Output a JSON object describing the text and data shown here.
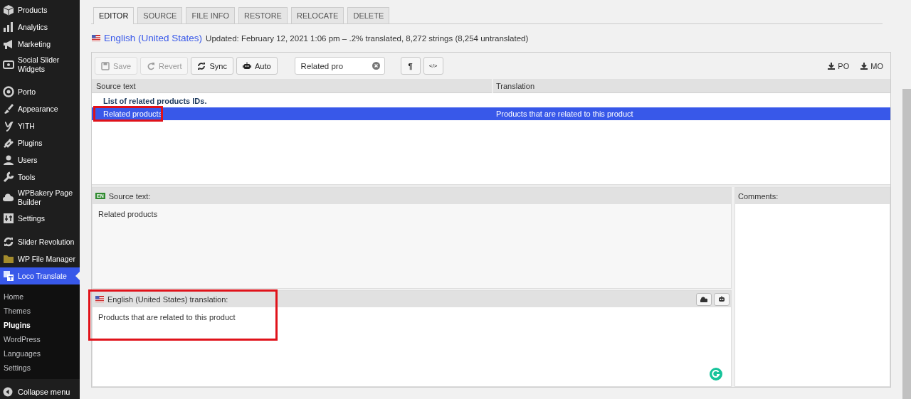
{
  "sidebar": {
    "groups": [
      [
        {
          "label": "Products",
          "selected": false
        },
        {
          "label": "Analytics",
          "selected": false
        },
        {
          "label": "Marketing",
          "selected": false
        },
        {
          "label": "Social Slider Widgets",
          "selected": false
        }
      ],
      [
        {
          "label": "Porto",
          "selected": false
        },
        {
          "label": "Appearance",
          "selected": false
        },
        {
          "label": "YITH",
          "selected": false
        },
        {
          "label": "Plugins",
          "selected": false
        },
        {
          "label": "Users",
          "selected": false
        },
        {
          "label": "Tools",
          "selected": false
        },
        {
          "label": "WPBakery Page Builder",
          "selected": false
        },
        {
          "label": "Settings",
          "selected": false
        }
      ],
      [
        {
          "label": "Slider Revolution",
          "selected": false
        },
        {
          "label": "WP File Manager",
          "selected": false
        },
        {
          "label": "Loco Translate",
          "selected": true
        }
      ]
    ],
    "submenu": [
      {
        "label": "Home",
        "selected": false
      },
      {
        "label": "Themes",
        "selected": false
      },
      {
        "label": "Plugins",
        "selected": true
      },
      {
        "label": "WordPress",
        "selected": false
      },
      {
        "label": "Languages",
        "selected": false
      },
      {
        "label": "Settings",
        "selected": false
      }
    ],
    "collapse": "Collapse menu"
  },
  "tabs": [
    {
      "label": "EDITOR",
      "selected": true
    },
    {
      "label": "SOURCE",
      "selected": false
    },
    {
      "label": "FILE INFO",
      "selected": false
    },
    {
      "label": "RESTORE",
      "selected": false
    },
    {
      "label": "RELOCATE",
      "selected": false
    },
    {
      "label": "DELETE",
      "selected": false
    }
  ],
  "header": {
    "language": "English (United States)",
    "meta": "Updated: February 12, 2021 1:06 pm – .2% translated, 8,272 strings (8,254 untranslated)"
  },
  "toolbar": {
    "buttons": [
      {
        "label": "Save",
        "disabled": true
      },
      {
        "label": "Revert",
        "disabled": true
      },
      {
        "label": "Sync",
        "disabled": false
      },
      {
        "label": "Auto",
        "disabled": false
      }
    ],
    "search": {
      "value": "Related pro"
    },
    "toggles": [
      "¶",
      "</>"
    ],
    "downloads": [
      "PO",
      "MO"
    ]
  },
  "table": {
    "columns": [
      "Source text",
      "Translation"
    ],
    "rows": [
      {
        "source": "List of related products IDs.",
        "translation": "",
        "translated": false,
        "selected": false,
        "annotated": false
      },
      {
        "source": "Related products",
        "translation": "Products that are related to this product",
        "translated": true,
        "selected": true,
        "annotated": true
      }
    ]
  },
  "source_pane": {
    "badge": "EN",
    "title": "Source text:",
    "text": "Related products"
  },
  "translation_pane": {
    "title": "English (United States) translation:",
    "text": "Products that are related to this product",
    "annotated": true
  },
  "comments_pane": {
    "title": "Comments:"
  }
}
